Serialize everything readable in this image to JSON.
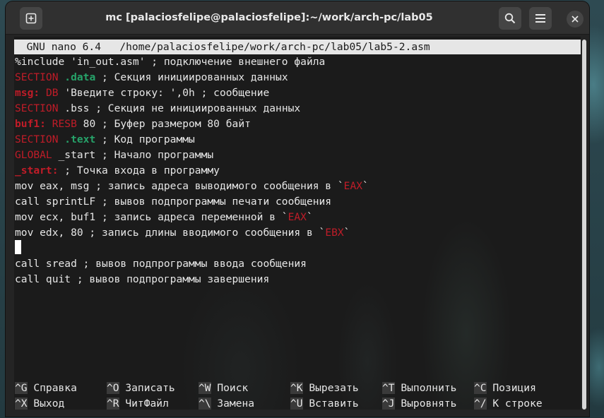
{
  "window": {
    "title": "mc [palaciosfelipe@palaciosfelipe]:~/work/arch-pc/lab05"
  },
  "nano": {
    "header": "  GNU nano 6.4   /home/palaciosfelipe/work/arch-pc/lab05/lab5-2.asm",
    "lines": [
      [
        {
          "t": "%include 'in_out.asm' ; подключение внешнего файла",
          "c": ""
        }
      ],
      [
        {
          "t": "SECTION ",
          "c": "red"
        },
        {
          "t": ".data",
          "c": "green"
        },
        {
          "t": " ; Секция инициированных данных",
          "c": ""
        }
      ],
      [
        {
          "t": "msg:",
          "c": "red bold"
        },
        {
          "t": " ",
          "c": ""
        },
        {
          "t": "DB",
          "c": "red"
        },
        {
          "t": " 'Введите строку: ',0h ; сообщение",
          "c": ""
        }
      ],
      [
        {
          "t": "SECTION",
          "c": "red"
        },
        {
          "t": " .bss ; Секция не инициированных данных",
          "c": ""
        }
      ],
      [
        {
          "t": "buf1:",
          "c": "red bold"
        },
        {
          "t": " ",
          "c": ""
        },
        {
          "t": "RESB",
          "c": "red"
        },
        {
          "t": " 80 ; Буфер размером 80 байт",
          "c": ""
        }
      ],
      [
        {
          "t": "SECTION ",
          "c": "red"
        },
        {
          "t": ".text",
          "c": "green"
        },
        {
          "t": " ; Код программы",
          "c": ""
        }
      ],
      [
        {
          "t": "GLOBAL",
          "c": "red"
        },
        {
          "t": " _start ; Начало программы",
          "c": ""
        }
      ],
      [
        {
          "t": "_start:",
          "c": "red bold"
        },
        {
          "t": " ; Точка входа в программу",
          "c": ""
        }
      ],
      [
        {
          "t": "mov eax, msg ; запись адреса выводимого сообщения в `",
          "c": ""
        },
        {
          "t": "EAX",
          "c": "red"
        },
        {
          "t": "`",
          "c": ""
        }
      ],
      [
        {
          "t": "call sprintLF ; вывов подпрограммы печати сообщения",
          "c": ""
        }
      ],
      [
        {
          "t": "mov ecx, buf1 ; запись адреса переменной в `",
          "c": ""
        },
        {
          "t": "EAX",
          "c": "red"
        },
        {
          "t": "`",
          "c": ""
        }
      ],
      [
        {
          "t": "mov edx, 80 ; запись длины вводимого сообщения в `",
          "c": ""
        },
        {
          "t": "EBX",
          "c": "red"
        },
        {
          "t": "`",
          "c": ""
        }
      ],
      [],
      [
        {
          "t": "call sread ; вывов подпрограммы ввода сообщения",
          "c": ""
        }
      ],
      [
        {
          "t": "call quit ; вывов подпрограммы завершения",
          "c": ""
        }
      ]
    ],
    "shortcuts_row1": [
      {
        "key": "^G",
        "label": "Справка"
      },
      {
        "key": "^O",
        "label": "Записать"
      },
      {
        "key": "^W",
        "label": "Поиск"
      },
      {
        "key": "^K",
        "label": "Вырезать"
      },
      {
        "key": "^T",
        "label": "Выполнить"
      },
      {
        "key": "^C",
        "label": "Позиция"
      }
    ],
    "shortcuts_row2": [
      {
        "key": "^X",
        "label": "Выход"
      },
      {
        "key": "^R",
        "label": "ЧитФайл"
      },
      {
        "key": "^\\",
        "label": "Замена"
      },
      {
        "key": "^U",
        "label": "Вставить"
      },
      {
        "key": "^J",
        "label": "Выровнять"
      },
      {
        "key": "^/",
        "label": "К строке"
      }
    ]
  },
  "icons": {
    "new_tab": "new-tab-icon",
    "search": "search-icon",
    "menu": "hamburger-menu-icon",
    "close": "close-icon"
  }
}
